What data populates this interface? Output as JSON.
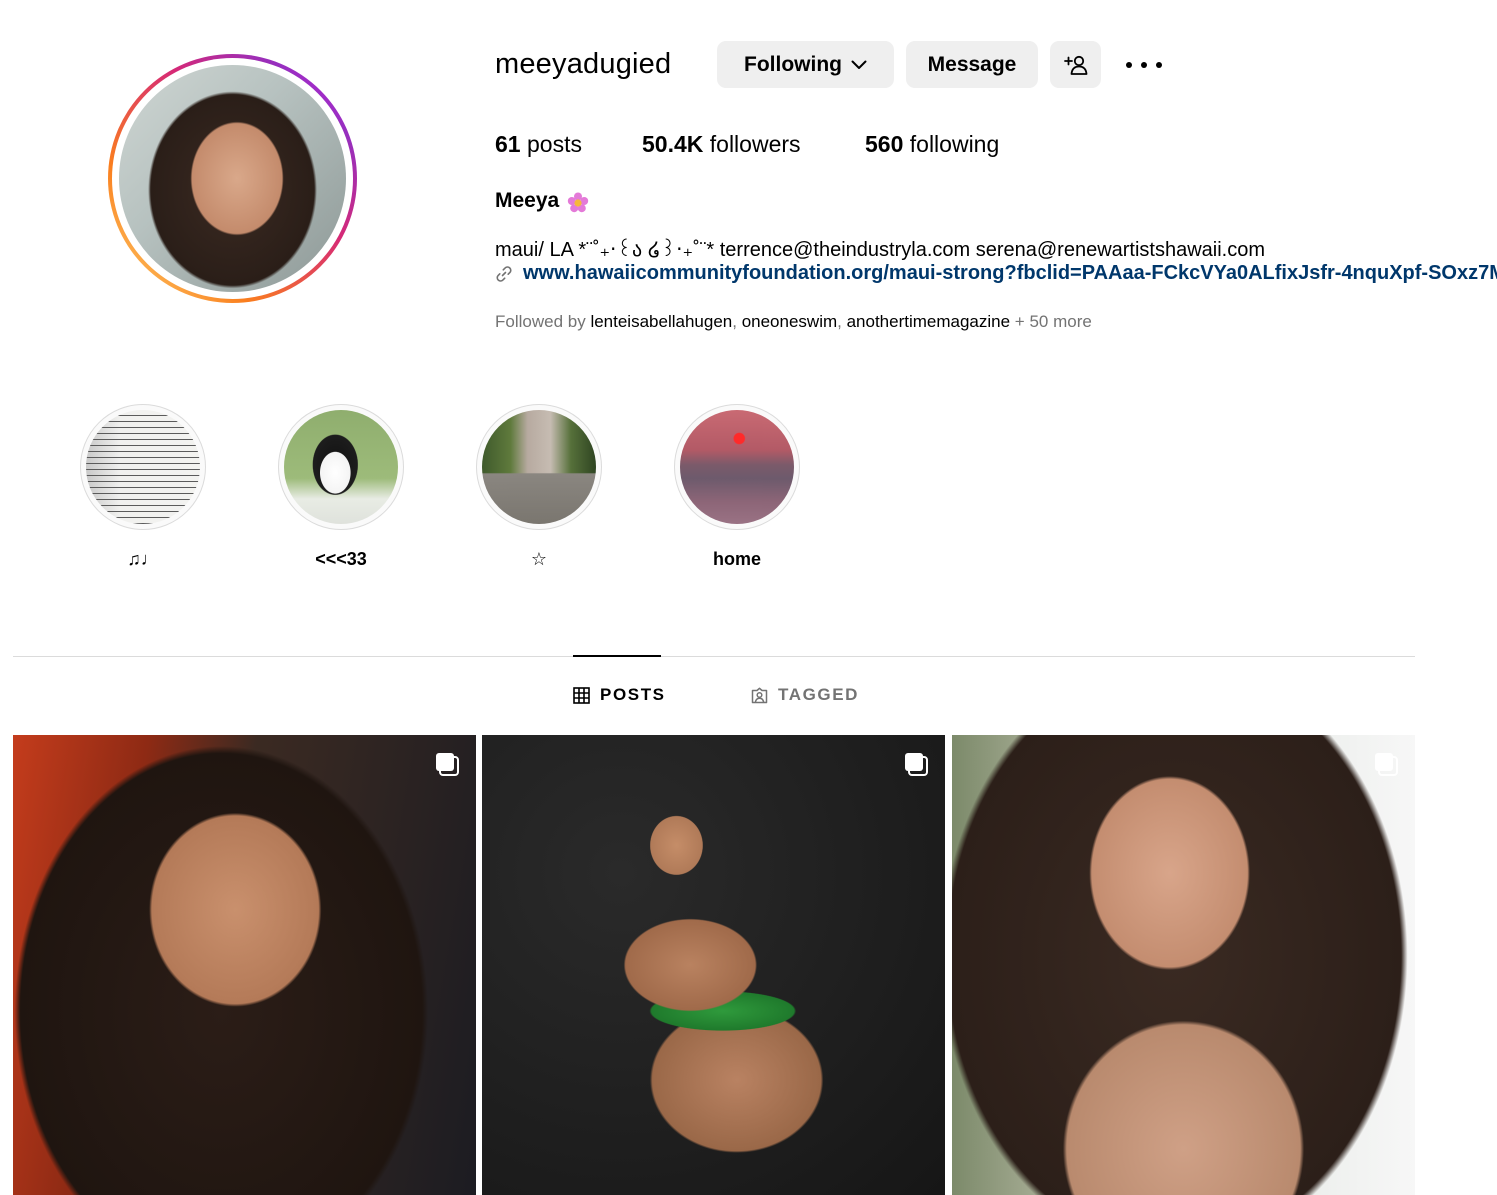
{
  "profile": {
    "username": "meeyadugied",
    "buttons": {
      "following": "Following",
      "message": "Message"
    },
    "stats": {
      "posts_count": "61",
      "posts_label": "posts",
      "followers_count": "50.4K",
      "followers_label": "followers",
      "following_count": "560",
      "following_label": "following"
    },
    "full_name": "Meeya",
    "bio": "maui/ LA *¨˚₊‧꒰ა ໒꒱‧₊˚¨* terrence@theindustryla.com serena@renewartistshawaii.com",
    "link": "www.hawaiicommunityfoundation.org/maui-strong?fbclid=PAAaa-FCkcVYa0ALfixJsfr-4nquXpf-SOxz7M",
    "followed_by": {
      "prefix": "Followed by ",
      "accounts": [
        "lenteisabellahugen",
        "oneoneswim",
        "anothertimemagazine"
      ],
      "separator": ", ",
      "suffix": " + 50 more"
    }
  },
  "highlights": [
    {
      "label": "♫♩"
    },
    {
      "label": "<<<33"
    },
    {
      "label": "☆"
    },
    {
      "label": "home"
    }
  ],
  "tabs": {
    "posts": "POSTS",
    "tagged": "TAGGED"
  },
  "icons": {
    "following_chevron": "chevron-down-icon",
    "add_user": "add-person-icon",
    "more": "more-options-icon",
    "link": "link-icon",
    "posts_tab": "grid-icon",
    "tagged_tab": "tagged-icon",
    "carousel": "multiple-posts-icon",
    "name_emoji": "flower-icon"
  },
  "colors": {
    "link": "#00376b",
    "secondary_text": "#737373",
    "button_bg": "#efefef",
    "divider": "#dbdbdb"
  }
}
